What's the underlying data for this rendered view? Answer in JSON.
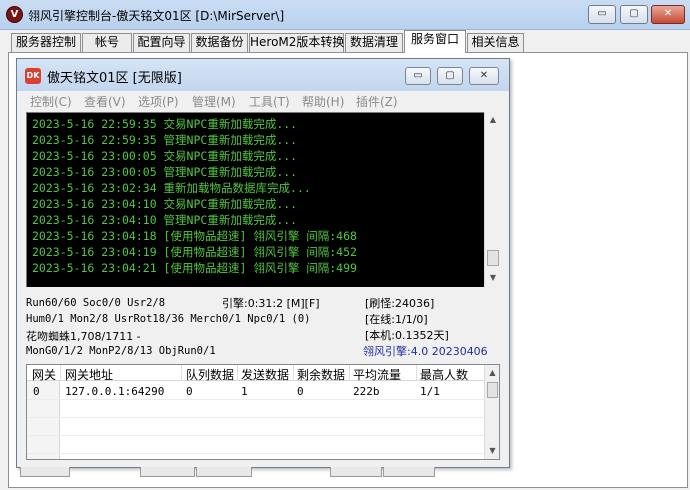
{
  "window": {
    "title": "翎风引擎控制台-傲天铭文01区 [D:\\MirServer\\]",
    "logo": "V",
    "min_glyph": "▭",
    "max_glyph": "▢",
    "close_glyph": "✕"
  },
  "tabs": [
    {
      "label": "服务器控制"
    },
    {
      "label": "帐号"
    },
    {
      "label": "配置向导"
    },
    {
      "label": "数据备份"
    },
    {
      "label": "HeroM2版本转换"
    },
    {
      "label": "数据清理"
    },
    {
      "label": "服务窗口",
      "active": true
    },
    {
      "label": "相关信息"
    }
  ],
  "inner": {
    "title": "傲天铭文01区 [无限版]",
    "logo": "DK",
    "min_glyph": "▭",
    "max_glyph": "▢",
    "close_glyph": "✕",
    "menu": [
      "控制(C)",
      "查看(V)",
      "选项(P)",
      "管理(M)",
      "工具(T)",
      "帮助(H)",
      "插件(Z)"
    ]
  },
  "log_lines": [
    "2023-5-16 22:59:35 交易NPC重新加载完成...",
    "2023-5-16 22:59:35 管理NPC重新加载完成...",
    "2023-5-16 23:00:05 交易NPC重新加载完成...",
    "2023-5-16 23:00:05 管理NPC重新加载完成...",
    "2023-5-16 23:02:34 重新加载物品数据库完成...",
    "2023-5-16 23:04:10 交易NPC重新加载完成...",
    "2023-5-16 23:04:10 管理NPC重新加载完成...",
    "2023-5-16 23:04:18 [使用物品超速] 翎风引擎 间隔:468",
    "2023-5-16 23:04:19 [使用物品超速] 翎风引擎 间隔:452",
    "2023-5-16 23:04:21 [使用物品超速] 翎风引擎 间隔:499"
  ],
  "status": {
    "run": "Run60/60 Soc0/0 Usr2/8",
    "engine": "引擎:0:31:2 [M][F]",
    "refresh": "[刷怪:24036]",
    "hum": "Hum0/1 Mon2/8 UsrRot18/36 Merch0/1 Npc0/1 (0)",
    "online": "[在线:1/1/0]",
    "map": "花吻蜘蛛1,708/1711 -",
    "local": "[本机:0.1352天]",
    "mon": "MonG0/1/2 MonP2/8/13 ObjRun0/1",
    "version": "翎风引擎:4.0 20230406"
  },
  "grid": {
    "headers": [
      "网关",
      "网关地址",
      "队列数据",
      "发送数据",
      "剩余数据",
      "平均流量",
      "最高人数"
    ],
    "rows": [
      [
        "0",
        "127.0.0.1:64290",
        "0",
        "1",
        "0",
        "222b",
        "1/1"
      ]
    ]
  },
  "scroll": {
    "up": "▲",
    "down": "▼"
  }
}
